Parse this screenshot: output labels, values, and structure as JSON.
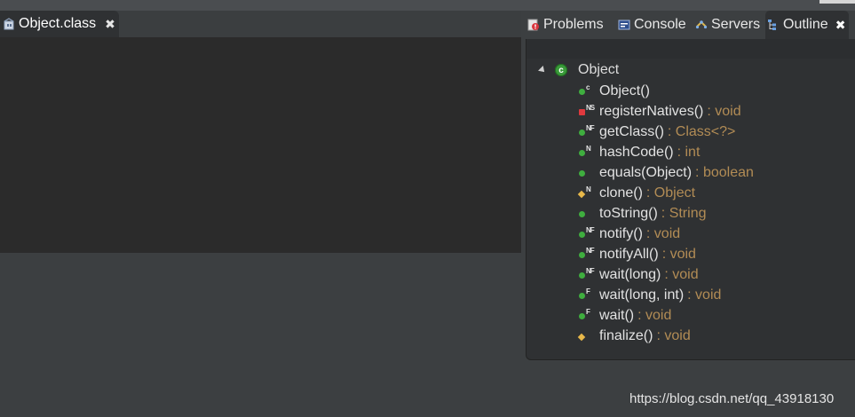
{
  "editor": {
    "tab": {
      "title": "Object.class",
      "icon": "class-file-icon",
      "close_glyph": "✖"
    }
  },
  "views": {
    "tabs": [
      {
        "label": "Problems",
        "icon": "problems-icon"
      },
      {
        "label": "Console",
        "icon": "console-icon"
      },
      {
        "label": "Servers",
        "icon": "servers-icon"
      },
      {
        "label": "Outline",
        "icon": "outline-icon",
        "active": true
      }
    ],
    "close_glyph": "✖"
  },
  "outline": {
    "root": {
      "label": "Object",
      "icon_letter": "c"
    },
    "members": [
      {
        "name": "Object()",
        "type": "",
        "visibility": "public",
        "adornment": "c"
      },
      {
        "name": "registerNatives()",
        "type": ": void",
        "visibility": "private",
        "adornment": "NS"
      },
      {
        "name": "getClass()",
        "type": ": Class<?>",
        "visibility": "public",
        "adornment": "NF"
      },
      {
        "name": "hashCode()",
        "type": ": int",
        "visibility": "public",
        "adornment": "N"
      },
      {
        "name": "equals(Object)",
        "type": ": boolean",
        "visibility": "public",
        "adornment": ""
      },
      {
        "name": "clone()",
        "type": ": Object",
        "visibility": "protected",
        "adornment": "N"
      },
      {
        "name": "toString()",
        "type": ": String",
        "visibility": "public",
        "adornment": ""
      },
      {
        "name": "notify()",
        "type": ": void",
        "visibility": "public",
        "adornment": "NF"
      },
      {
        "name": "notifyAll()",
        "type": ": void",
        "visibility": "public",
        "adornment": "NF"
      },
      {
        "name": "wait(long)",
        "type": ": void",
        "visibility": "public",
        "adornment": "NF"
      },
      {
        "name": "wait(long, int)",
        "type": ": void",
        "visibility": "public",
        "adornment": "F"
      },
      {
        "name": "wait()",
        "type": ": void",
        "visibility": "public",
        "adornment": "F"
      },
      {
        "name": "finalize()",
        "type": ": void",
        "visibility": "protected",
        "adornment": ""
      }
    ]
  },
  "watermark": "https://blog.csdn.net/qq_43918130",
  "colors": {
    "editor_bg": "#2b2b2b",
    "panel_bg": "#2f3133",
    "type_text": "#b28c55",
    "public_dot": "#3fae3f",
    "private_dot": "#e0393e",
    "protected_dot": "#e8b84a"
  }
}
